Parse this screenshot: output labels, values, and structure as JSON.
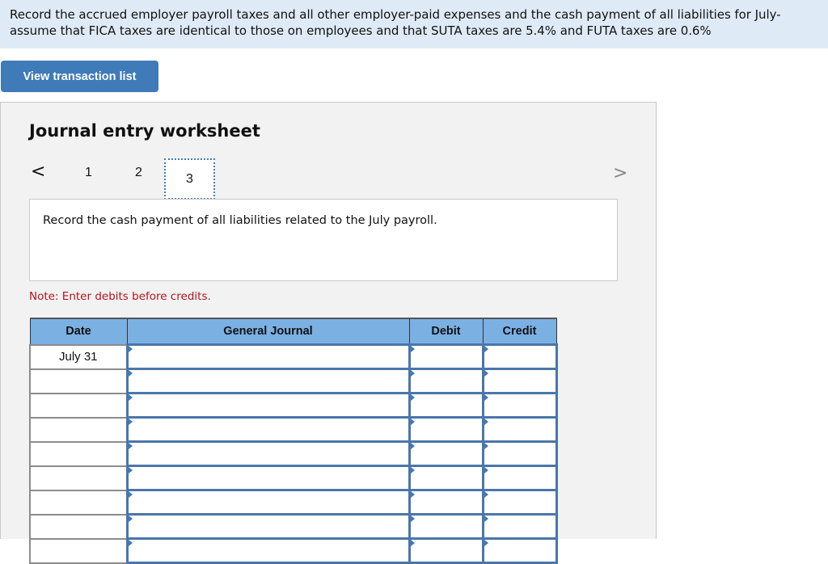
{
  "banner": {
    "text": "Record the accrued employer payroll taxes and all other employer-paid expenses and the cash payment of all liabilities for July-assume that FICA taxes are identical to those on employees and that SUTA taxes are 5.4% and FUTA taxes are 0.6%"
  },
  "toolbar": {
    "view_transaction_list_label": "View transaction list"
  },
  "worksheet": {
    "title": "Journal entry worksheet",
    "nav": {
      "prev_icon": "chevron-left-icon",
      "next_icon": "chevron-right-icon",
      "prev_glyph": "<",
      "next_glyph": ">"
    },
    "tabs": [
      {
        "label": "1"
      },
      {
        "label": "2"
      },
      {
        "label": "3",
        "active": true
      }
    ],
    "instruction": "Record the cash payment of all liabilities related to the July payroll.",
    "note": "Note: Enter debits before credits.",
    "table": {
      "headers": [
        "Date",
        "General Journal",
        "Debit",
        "Credit"
      ],
      "rows": [
        {
          "date": "July 31",
          "account": "",
          "debit": "",
          "credit": ""
        },
        {
          "date": "",
          "account": "",
          "debit": "",
          "credit": ""
        },
        {
          "date": "",
          "account": "",
          "debit": "",
          "credit": ""
        },
        {
          "date": "",
          "account": "",
          "debit": "",
          "credit": ""
        },
        {
          "date": "",
          "account": "",
          "debit": "",
          "credit": ""
        },
        {
          "date": "",
          "account": "",
          "debit": "",
          "credit": ""
        },
        {
          "date": "",
          "account": "",
          "debit": "",
          "credit": ""
        },
        {
          "date": "",
          "account": "",
          "debit": "",
          "credit": ""
        },
        {
          "date": "",
          "account": "",
          "debit": "",
          "credit": ""
        }
      ]
    }
  },
  "colors": {
    "banner_bg": "#deebf7",
    "button_bg": "#3f7ab9",
    "header_bg": "#7bb0e3",
    "note_text": "#b0151a"
  }
}
